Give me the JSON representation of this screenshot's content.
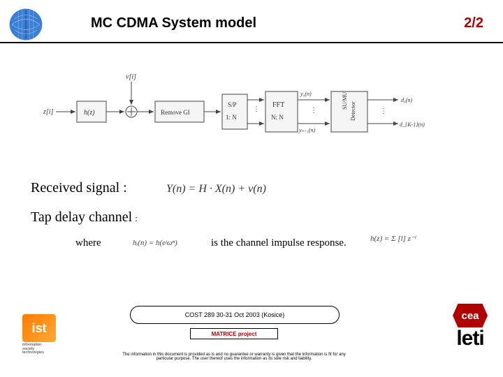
{
  "header": {
    "title": "MC CDMA System model",
    "page": "2/2"
  },
  "diagram": {
    "z_label": "z[i]",
    "v_label": "v[i]",
    "hz_label": "h(z)",
    "remove_gi": "Remove GI",
    "sp_top": "S/P",
    "sp_bot": "1: N",
    "fft_top": "FFT",
    "fft_bot": "N: N",
    "y0": "y₀(n)",
    "yn1": "yₙ₋₁(n)",
    "det_top": "SU/MU",
    "det_bot": "Detector",
    "d0": "d₀(n)",
    "dk1": "d_{K-1}(n)"
  },
  "body": {
    "received": "Received signal :",
    "eq1": "Y(n) = H · X(n) + v(n)",
    "tap": "Tap delay channel",
    "tap_colon": ":",
    "where": "where",
    "eq2": "hᵢ(n) = h(eʲωⁿ)",
    "impulse_text": "is the channel impulse response.",
    "eq3": "h(z) = Σ [l] z⁻ˡ"
  },
  "footer": {
    "ist_abbr": "ist",
    "ist_caption1": "information",
    "ist_caption2": "society",
    "ist_caption3": "technologies",
    "bubble": "COST 289 30-31 Oct 2003 (Kosice)",
    "project": "MATRICE project",
    "disclaimer": "The information in this document is provided as is and no guarantee or warranty is given that the information is fit for any particular purpose. The user thereof uses the information as its sole risk and liability.",
    "cea": "cea",
    "leti": "leti"
  }
}
